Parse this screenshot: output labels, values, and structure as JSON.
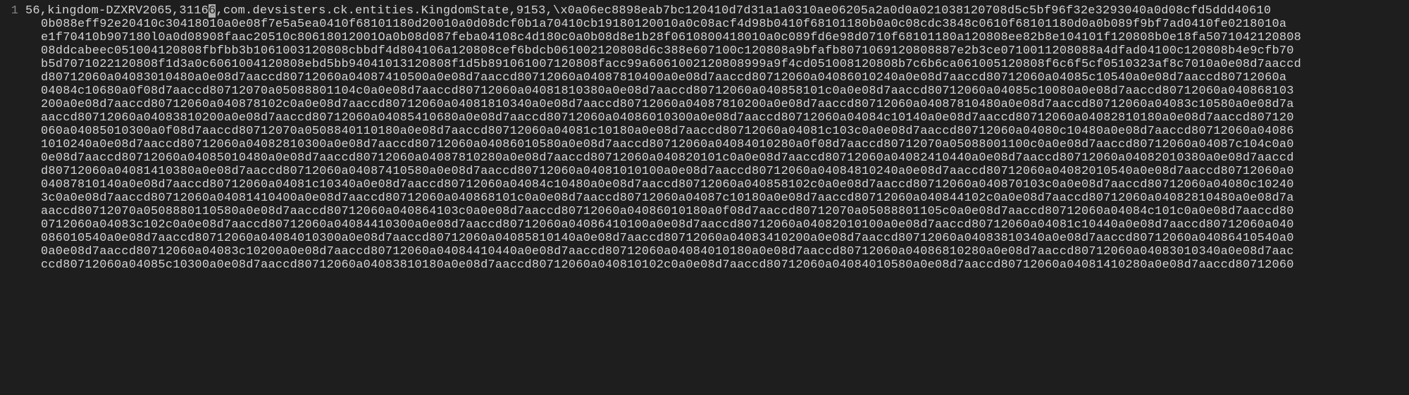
{
  "file": {
    "name": "dat.csv"
  },
  "gutter": {
    "line1": "1"
  },
  "row": {
    "prefix": "56,kingdom-DZXRV2065,3116",
    "cursor_char": "6",
    "after_cursor": ",com.devsisters.ck.entities.KingdomState,9153,\\x0a06ec8898eab7bc120410d7d31a1a0310ae06205a2a0d0a021038120708d5c5bf96f32e3293040a0d08cfd5ddd40610"
  },
  "continuations": [
    "0b088eff92e20410c30418010a0e08f7e5a5ea0410f68101180d20010a0d08dcf0b1a70410cb19180120010a0c08acf4d98b0410f68101180b0a0c08cdc3848c0610f68101180d0a0b089f9bf7ad0410fe0218010a",
    "e1f70410b907180l0a0d08908faac20510c80618012001Oa0b08d087feba04108c4d180c0a0b08d8e1b28f0610800418010a0c089fd6e98d0710f68101180a120808ee82b8e104101f120808b0e18fa5071042120808",
    "08ddcabeec051004120808fbfbb3b1061003120808cbbdf4d804106a120808cef6bdcb061002120808d6c388e607100c120808a9bfafb8071069120808887e2b3ce0710011208088a4dfad04100c120808b4e9cfb70",
    "b5d7071022120808f1d3a0c6061004120808ebd5bb94041013120808f1d5b891061007120808facc99a6061002120808999a9f4cd051008120808b7c6b6ca061005120808f6c6f5cf0510323af8c7010a0e08d7aaccd",
    "d80712060a04083010480a0e08d7aaccd80712060a04087410500a0e08d7aaccd80712060a04087810400a0e08d7aaccd80712060a04086010240a0e08d7aaccd80712060a04085c10540a0e08d7aaccd80712060a",
    "04084c10680a0f08d7aaccd80712070a05088801104c0a0e08d7aaccd80712060a04081810380a0e08d7aaccd80712060a040858101c0a0e08d7aaccd80712060a04085c10080a0e08d7aaccd80712060a040868103",
    "200a0e08d7aaccd80712060a040878102c0a0e08d7aaccd80712060a04081810340a0e08d7aaccd80712060a04087810200a0e08d7aaccd80712060a04087810480a0e08d7aaccd80712060a04083c10580a0e08d7a",
    "aaccd80712060a04083810200a0e08d7aaccd80712060a04085410680a0e08d7aaccd80712060a04086010300a0e08d7aaccd80712060a04084c10140a0e08d7aaccd80712060a04082810180a0e08d7aaccd807120",
    "060a04085010300a0f08d7aaccd80712070a0508840110180a0e08d7aaccd80712060a04081c10180a0e08d7aaccd80712060a04081c103c0a0e08d7aaccd80712060a04080c10480a0e08d7aaccd80712060a04086",
    "1010240a0e08d7aaccd80712060a04082810300a0e08d7aaccd80712060a04086010580a0e08d7aaccd80712060a04084010280a0f08d7aaccd80712070a05088001100c0a0e08d7aaccd80712060a04087c104c0a0",
    "0e08d7aaccd80712060a04085010480a0e08d7aaccd80712060a04087810280a0e08d7aaccd80712060a040820101c0a0e08d7aaccd80712060a04082410440a0e08d7aaccd80712060a04082010380a0e08d7aaccd",
    "d80712060a04081410380a0e08d7aaccd80712060a04087410580a0e08d7aaccd80712060a04081010100a0e08d7aaccd80712060a04084810240a0e08d7aaccd80712060a04082010540a0e08d7aaccd80712060a0",
    "04087810140a0e08d7aaccd80712060a04081c10340a0e08d7aaccd80712060a04084c10480a0e08d7aaccd80712060a040858102c0a0e08d7aaccd80712060a040870103c0a0e08d7aaccd80712060a04080c10240",
    "3c0a0e08d7aaccd80712060a04081410400a0e08d7aaccd80712060a040868101c0a0e08d7aaccd80712060a04087c10180a0e08d7aaccd80712060a040844102c0a0e08d7aaccd80712060a04082810480a0e08d7a",
    "aaccd80712070a0508880110580a0e08d7aaccd80712060a040864103c0a0e08d7aaccd80712060a04086010180a0f08d7aaccd80712070a05088801105c0a0e08d7aaccd80712060a04084c101c0a0e08d7aaccd80",
    "0712060a04083c102c0a0e08d7aaccd80712060a04084410300a0e08d7aaccd80712060a04086410100a0e08d7aaccd80712060a04082010100a0e08d7aaccd80712060a04081c10440a0e08d7aaccd80712060a040",
    "086010540a0e08d7aaccd80712060a04084010300a0e08d7aaccd80712060a04085810140a0e08d7aaccd80712060a04083410200a0e08d7aaccd80712060a04083810340a0e08d7aaccd80712060a04086410540a0",
    "0a0e08d7aaccd80712060a04083c10200a0e08d7aaccd80712060a04084410440a0e08d7aaccd80712060a04084010180a0e08d7aaccd80712060a04086810280a0e08d7aaccd80712060a04083010340a0e08d7aac",
    "ccd80712060a04085c10300a0e08d7aaccd80712060a04083810180a0e08d7aaccd80712060a040810102c0a0e08d7aaccd80712060a04084010580a0e08d7aaccd80712060a04081410280a0e08d7aaccd80712060"
  ]
}
